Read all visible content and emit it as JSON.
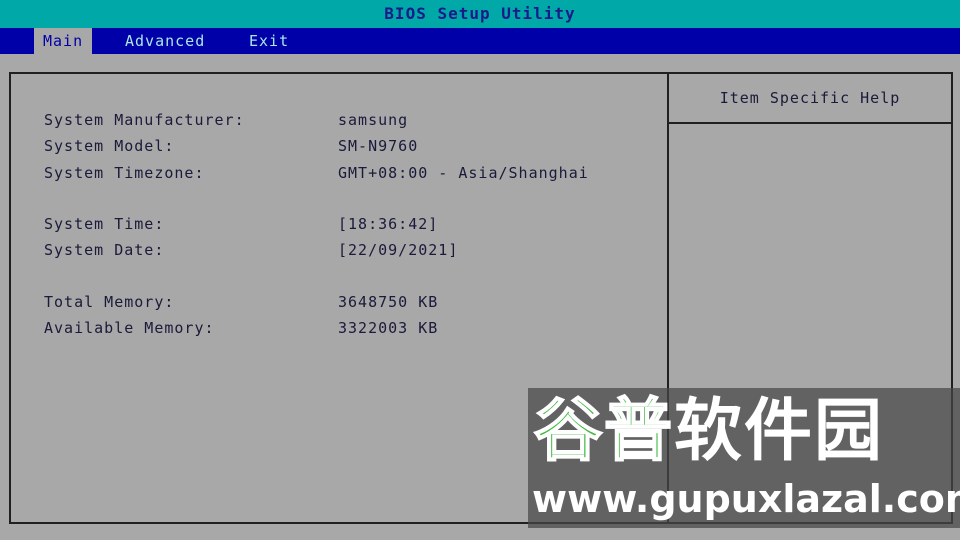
{
  "window": {
    "title": "BIOS Setup Utility"
  },
  "menu": {
    "items": [
      {
        "label": "Main",
        "active": true
      },
      {
        "label": "Advanced",
        "active": false
      },
      {
        "label": "Exit",
        "active": false
      }
    ]
  },
  "help": {
    "title": "Item Specific Help"
  },
  "info": {
    "manufacturer": {
      "label": "System Manufacturer:",
      "value": "samsung"
    },
    "model": {
      "label": "System Model:",
      "value": "SM-N9760"
    },
    "timezone": {
      "label": "System Timezone:",
      "value": "GMT+08:00 - Asia/Shanghai"
    },
    "time": {
      "label": "System Time:",
      "value": "[18:36:42]"
    },
    "date": {
      "label": "System Date:",
      "value": "[22/09/2021]"
    },
    "total_memory": {
      "label": "Total Memory:",
      "value": "3648750 KB"
    },
    "available_memory": {
      "label": "Available Memory:",
      "value": "3322003 KB"
    }
  },
  "watermark": {
    "cn_part1": "谷普",
    "cn_part2": "软件园",
    "url": "www.gupuxlazal.com"
  },
  "colors": {
    "title_bar": "#00a8a8",
    "menu_bar": "#0000a8",
    "panel_bg": "#a8a8a8",
    "text": "#1a1a3a",
    "watermark_green": "#3fb83f"
  }
}
